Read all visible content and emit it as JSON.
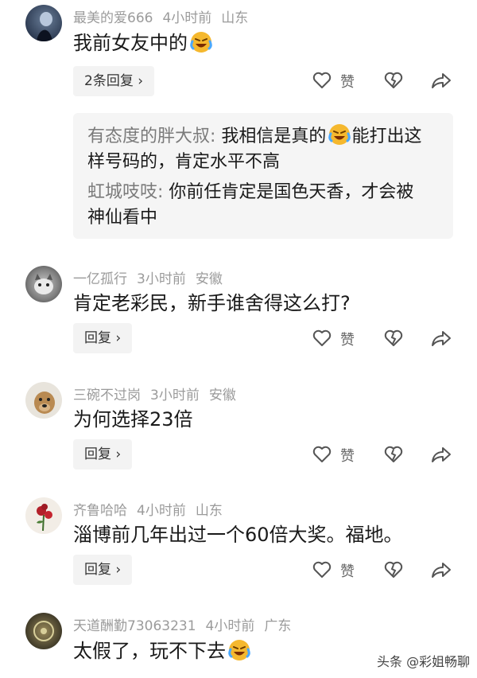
{
  "comments": [
    {
      "username": "最美的爱666",
      "time": "4小时前",
      "location": "山东",
      "text": "我前女友中的",
      "reply_button": "2条回复",
      "like_label": "赞",
      "replies": [
        {
          "name": "有态度的胖大叔",
          "sep": ": ",
          "pre": "我相信是真的",
          "post": "能打出这",
          "line2": "样号码的，肯定水平不高"
        },
        {
          "name": "虹城吱吱",
          "sep": ": ",
          "pre": "你前任肯定是国色天香，才会被",
          "line2": "神仙看中"
        }
      ]
    },
    {
      "username": "一亿孤行",
      "time": "3小时前",
      "location": "安徽",
      "text": "肯定老彩民，新手谁舍得这么打?",
      "reply_button": "回复",
      "like_label": "赞"
    },
    {
      "username": "三碗不过岗",
      "time": "3小时前",
      "location": "安徽",
      "text": "为何选择23倍",
      "reply_button": "回复",
      "like_label": "赞"
    },
    {
      "username": "齐鲁哈哈",
      "time": "4小时前",
      "location": "山东",
      "text": "淄博前几年出过一个60倍大奖。福地。",
      "reply_button": "回复",
      "like_label": "赞"
    },
    {
      "username": "天道酬勤73063231",
      "time": "4小时前",
      "location": "广东",
      "text": "太假了，玩不下去"
    }
  ],
  "icons": {
    "like": "heart-outline-icon",
    "dislike": "broken-heart-icon",
    "share": "share-arrow-icon",
    "emoji": "crying-laughing-emoji-icon",
    "reply_arrow": "chevron-right-icon"
  },
  "watermark": "头条 @彩姐畅聊",
  "colors": {
    "meta": "#9b9b9b",
    "reply_bg": "#f5f5f5",
    "button_bg": "#f3f3f3",
    "emoji": "#f5b82e"
  }
}
